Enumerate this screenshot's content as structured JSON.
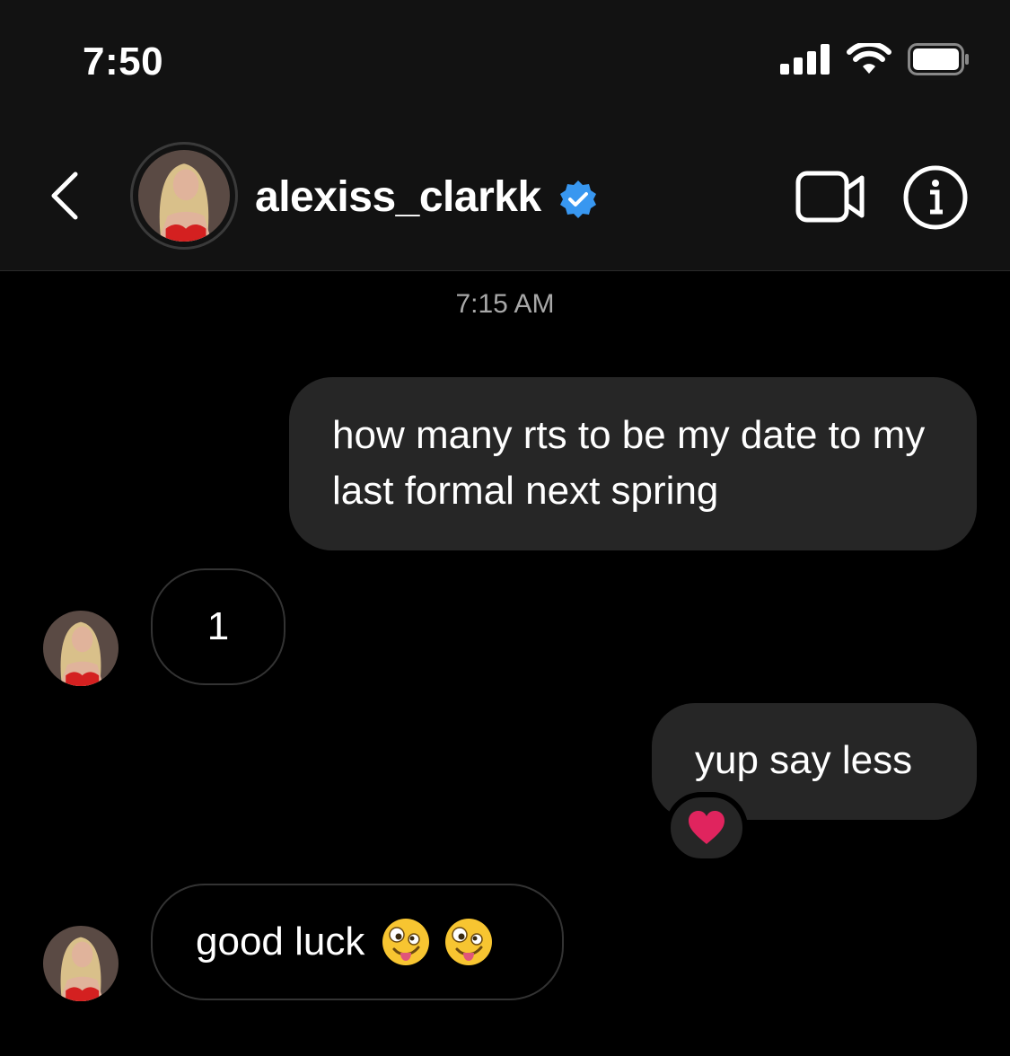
{
  "status_bar": {
    "time": "7:50"
  },
  "header": {
    "username": "alexiss_clarkk"
  },
  "chat": {
    "timestamp": "7:15 AM",
    "messages": [
      {
        "sender": "me",
        "text": "how many rts to be my date to my last formal next spring"
      },
      {
        "sender": "them",
        "text": "1"
      },
      {
        "sender": "me",
        "text": "yup say less",
        "reaction": "heart"
      },
      {
        "sender": "them",
        "text": "good luck",
        "emojis": [
          "zany-face",
          "zany-face"
        ]
      }
    ]
  },
  "colors": {
    "verified": "#3897f0",
    "bubble_out": "#262626",
    "background": "#000000",
    "header": "#121212",
    "heart": "#e0245e"
  }
}
